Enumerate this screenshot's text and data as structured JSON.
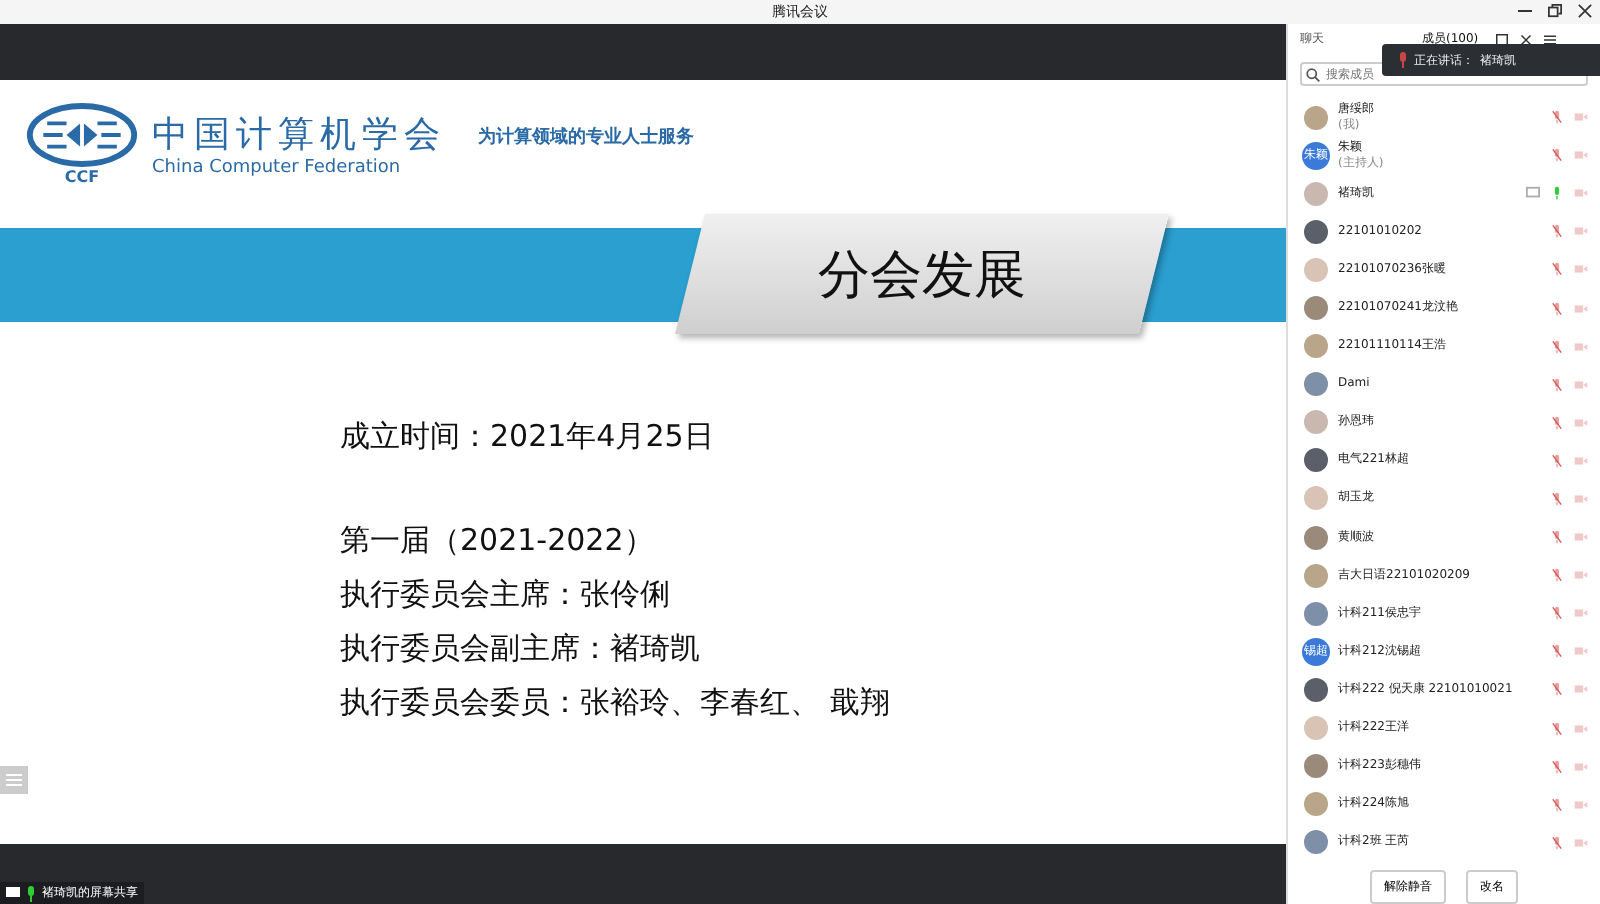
{
  "window": {
    "title": "腾讯会议"
  },
  "slide": {
    "org_name": "中国计算机学会",
    "org_name_en": "China Computer Federation",
    "slogan": "为计算领域的专业人士服务",
    "logo_text": "CCF",
    "heading": "分会发展",
    "lines": [
      "成立时间：2021年4月25日",
      "第一届（2021-2022）",
      "执行委员会主席：张伶俐",
      "执行委员会副主席：褚琦凯",
      "执行委员会委员：张裕玲、李春红、 戢翔"
    ]
  },
  "share_label": "褚琦凯的屏幕共享",
  "panel": {
    "tabs": [
      {
        "label": "聊天",
        "selected": false
      },
      {
        "label": "成员(100)",
        "selected": true
      }
    ],
    "search": {
      "placeholder": "搜索成员"
    },
    "speaking": {
      "label": "正在讲话：",
      "name": "褚琦凯"
    },
    "members": [
      {
        "name": "唐绥郎",
        "role": "(我)",
        "muted": true
      },
      {
        "name": "朱颖",
        "role": "(主持人)",
        "avatar_text": "朱颖",
        "muted": true
      },
      {
        "name": "褚琦凯",
        "muted": false
      },
      {
        "name": "22101010202",
        "muted": true
      },
      {
        "name": "22101070236张暖",
        "muted": true
      },
      {
        "name": "22101070241龙汶艳",
        "muted": true
      },
      {
        "name": "22101110114王浩",
        "muted": true
      },
      {
        "name": "Dami",
        "muted": true
      },
      {
        "name": "孙恩玮",
        "muted": true
      },
      {
        "name": "电气221林超",
        "muted": true
      },
      {
        "name": "胡玉龙",
        "muted": true
      },
      {
        "name": "黄顺波",
        "muted": true
      },
      {
        "name": "吉大日语22101020209",
        "muted": true
      },
      {
        "name": "计科211侯忠宇",
        "muted": true
      },
      {
        "name": "计科212沈锡超",
        "avatar_text": "锡超",
        "muted": true
      },
      {
        "name": "计科222 倪天康 22101010021",
        "muted": true
      },
      {
        "name": "计科222王洋",
        "muted": true
      },
      {
        "name": "计科223彭穗伟",
        "muted": true
      },
      {
        "name": "计科224陈旭",
        "muted": true
      },
      {
        "name": "计科2班 王芮",
        "muted": true
      }
    ],
    "buttons": [
      "解除静音",
      "改名"
    ]
  }
}
